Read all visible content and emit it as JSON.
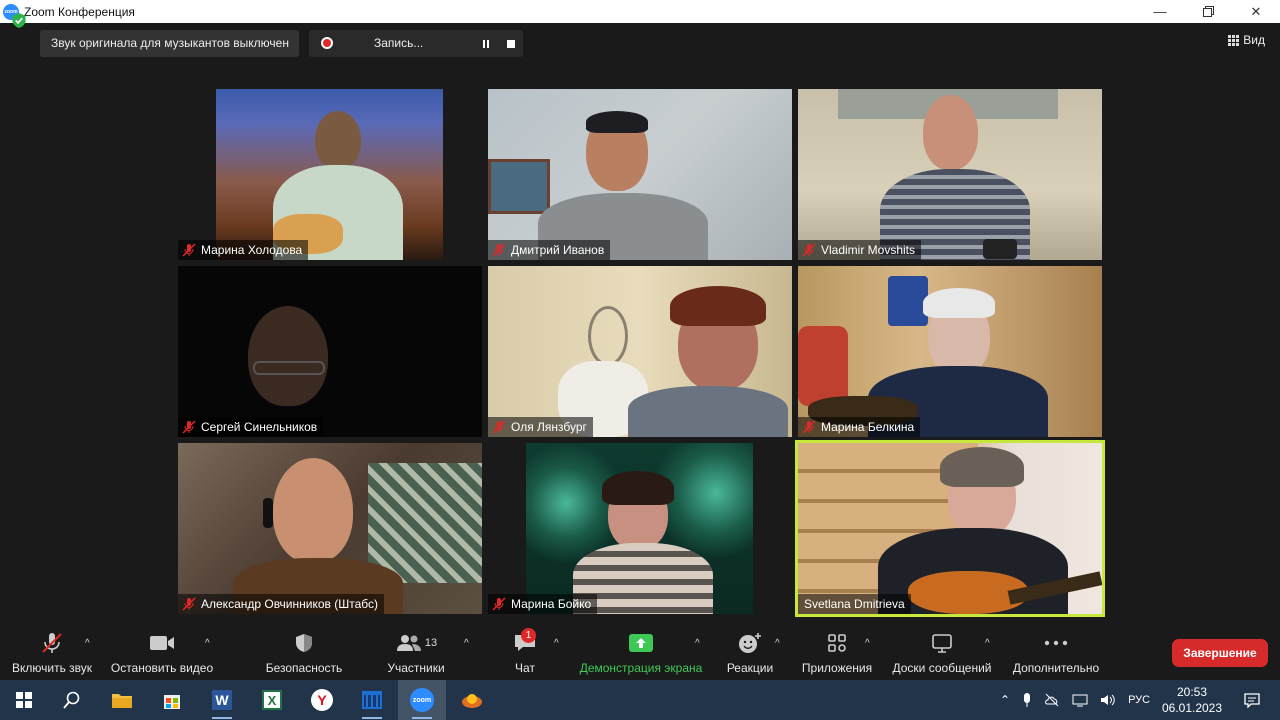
{
  "window": {
    "title": "Zoom Конференция"
  },
  "topbar": {
    "sound_status": "Звук оригинала для музыкантов выключен",
    "recording_label": "Запись...",
    "view_label": "Вид"
  },
  "participants": [
    {
      "name": "Марина Холодова",
      "muted": true
    },
    {
      "name": "Дмитрий Иванов",
      "muted": true
    },
    {
      "name": "Vladimir Movshits",
      "muted": true
    },
    {
      "name": "Сергей Синельников",
      "muted": true
    },
    {
      "name": "Оля Лянзбург",
      "muted": true
    },
    {
      "name": "Марина Белкина",
      "muted": true
    },
    {
      "name": "Александр Овчинников (Штабс)",
      "muted": true
    },
    {
      "name": "Марина Бойко",
      "muted": true
    },
    {
      "name": "Svetlana Dmitrieva",
      "muted": false,
      "active_speaker": true
    }
  ],
  "toolbar": {
    "unmute": "Включить звук",
    "stop_video": "Остановить видео",
    "security": "Безопасность",
    "participants": "Участники",
    "participants_count": "13",
    "chat": "Чат",
    "chat_badge": "1",
    "share": "Демонстрация экрана",
    "reactions": "Реакции",
    "apps": "Приложения",
    "whiteboards": "Доски сообщений",
    "more": "Дополнительно",
    "end": "Завершение"
  },
  "taskbar": {
    "language": "РУС",
    "time": "20:53",
    "date": "06.01.2023",
    "zoom_icon_text": "zoom",
    "word_letter": "W",
    "excel_letter": "X",
    "browser_letter": "Y"
  },
  "colors": {
    "accent_green": "#3ec956",
    "end_red": "#d72b2b",
    "active_speaker": "#c6e83a"
  }
}
